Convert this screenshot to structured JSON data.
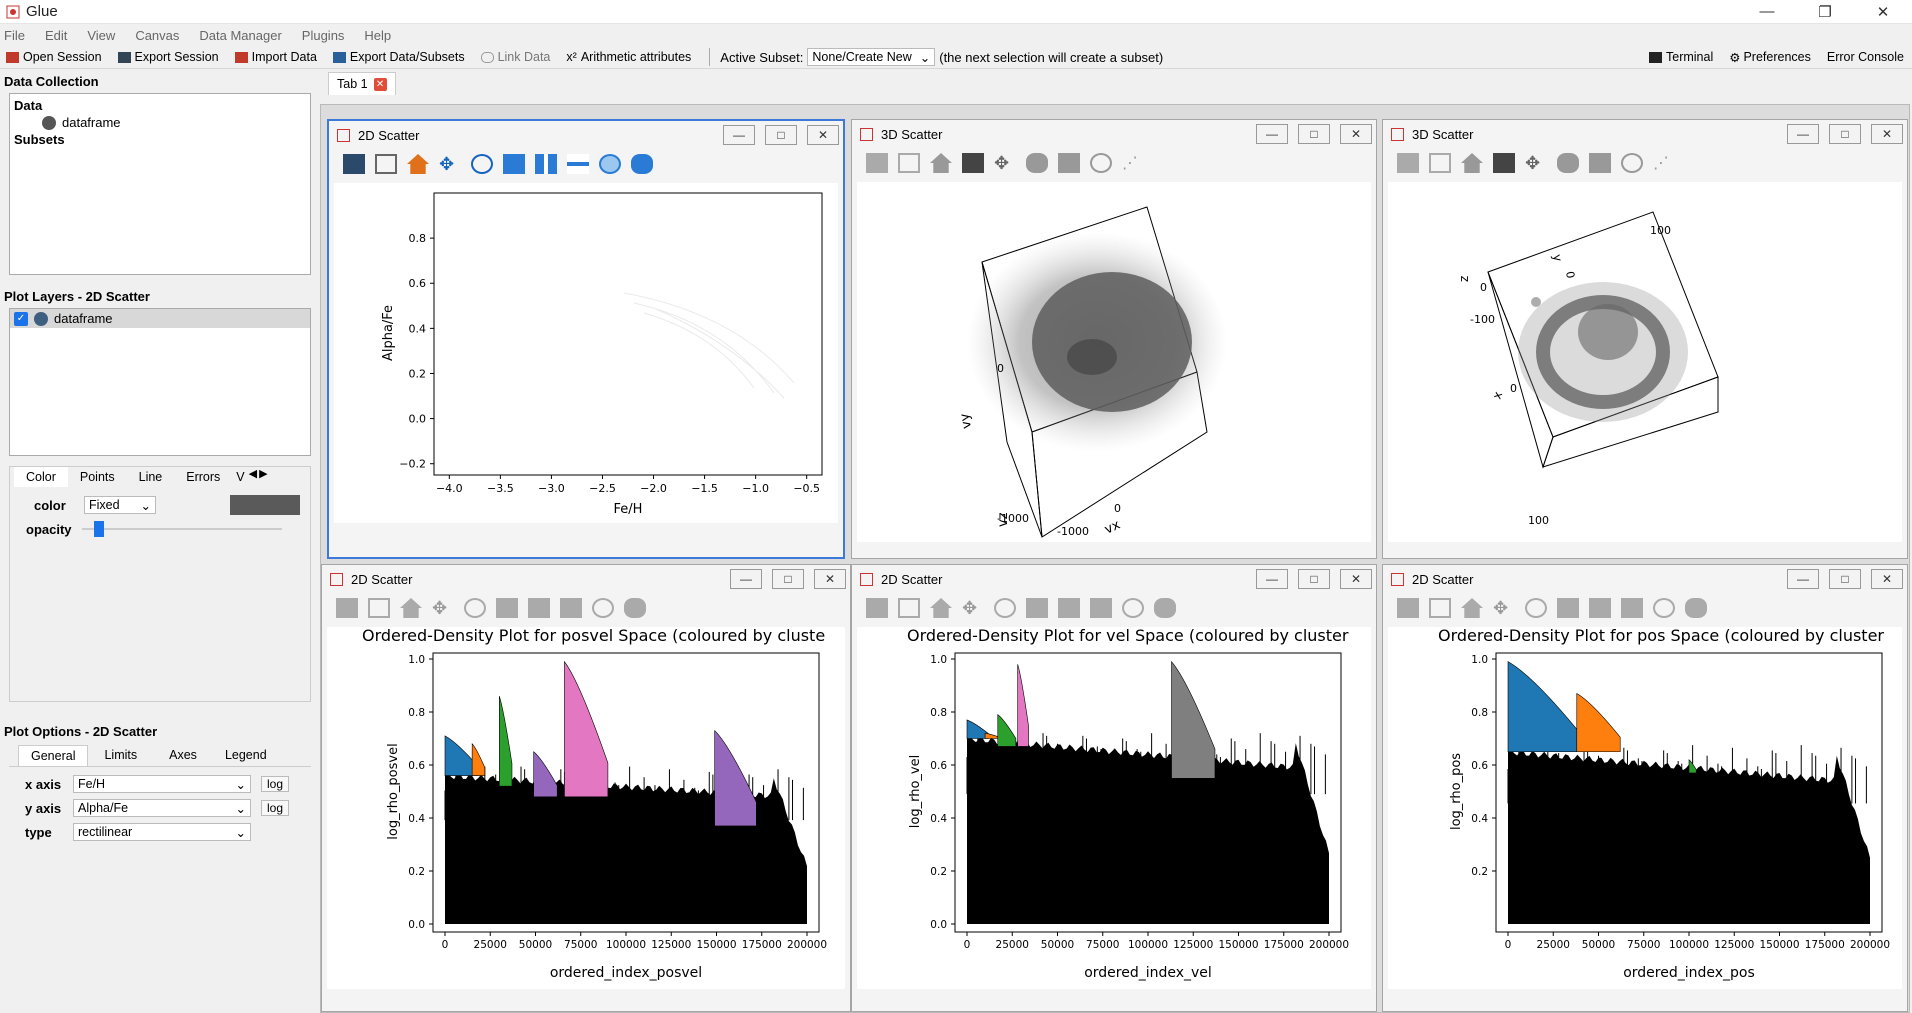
{
  "window": {
    "title": "Glue",
    "min": "—",
    "max": "❐",
    "close": "✕"
  },
  "menu": [
    "File",
    "Edit",
    "View",
    "Canvas",
    "Data Manager",
    "Plugins",
    "Help"
  ],
  "toolbar": {
    "open": "Open Session",
    "export": "Export Session",
    "import": "Import Data",
    "exportdata": "Export Data/Subsets",
    "link": "Link Data",
    "arith": "Arithmetic attributes",
    "active_label": "Active Subset:",
    "active_value": "None/Create New",
    "note": "(the next selection will create a subset)",
    "terminal": "Terminal",
    "prefs": "Preferences",
    "errcon": "Error Console"
  },
  "left": {
    "data_collection": "Data Collection",
    "data": "Data",
    "dataset": "dataframe",
    "subsets": "Subsets",
    "layers_title": "Plot Layers - 2D Scatter",
    "layer": "dataframe",
    "layer_tabs": [
      "Color",
      "Points",
      "Line",
      "Errors",
      "V"
    ],
    "color_label": "color",
    "color_mode": "Fixed",
    "opacity_label": "opacity",
    "options_title": "Plot Options - 2D Scatter",
    "opt_tabs": [
      "General",
      "Limits",
      "Axes",
      "Legend"
    ],
    "x_label": "x axis",
    "x_value": "Fe/H",
    "y_label": "y axis",
    "y_value": "Alpha/Fe",
    "type_label": "type",
    "type_value": "rectilinear",
    "log": "log"
  },
  "tab": "Tab 1",
  "colors": {
    "blue": "#1f77b4",
    "orange": "#ff7f0e",
    "green": "#2ca02c",
    "purple": "#9467bd",
    "pink": "#e377c2",
    "gray": "#7f7f7f",
    "accent": "#3c79d8"
  },
  "panels": {
    "p1": {
      "title": "2D Scatter"
    },
    "p2": {
      "title": "3D Scatter",
      "ax_vx": "vx",
      "ax_vy": "vy",
      "ax_vz": "vz",
      "t0a": "0",
      "t0b": "0",
      "tm1000a": "-1000",
      "tm1000b": "-1000"
    },
    "p3": {
      "title": "3D Scatter",
      "ax_x": "x",
      "ax_y": "y",
      "ax_z": "z",
      "t100a": "100",
      "t100b": "100",
      "t0a": "0",
      "t0b": "0",
      "t0c": "0",
      "tm100": "-100"
    },
    "p4": {
      "title": "2D Scatter"
    },
    "p5": {
      "title": "2D Scatter"
    },
    "p6": {
      "title": "2D Scatter"
    }
  },
  "chart_data": [
    {
      "type": "scatter",
      "xlabel": "Fe/H",
      "ylabel": "Alpha/Fe",
      "xlim": [
        -4.15,
        -0.35
      ],
      "ylim": [
        -0.25,
        1.0
      ],
      "xticks": [
        "−4.0",
        "−3.5",
        "−3.0",
        "−2.5",
        "−2.0",
        "−1.5",
        "−1.0",
        "−0.5"
      ],
      "yticks": [
        "−0.2",
        "0.0",
        "0.2",
        "0.4",
        "0.6",
        "0.8"
      ]
    },
    {
      "type": "bar",
      "title": "Ordered-Density Plot for posvel Space (coloured by cluste",
      "xlabel": "ordered_index_posvel",
      "ylabel": "log_rho_posvel",
      "xlim": [
        0,
        200000
      ],
      "ylim": [
        0,
        1.0
      ],
      "xticks": [
        "0",
        "25000",
        "50000",
        "75000",
        "100000",
        "125000",
        "150000",
        "175000",
        "200000"
      ],
      "yticks": [
        "0.0",
        "0.2",
        "0.4",
        "0.6",
        "0.8",
        "1.0"
      ],
      "clusters": [
        {
          "color": "blue",
          "start": 0,
          "end": 18000,
          "top": 0.71,
          "base": 0.56
        },
        {
          "color": "orange",
          "start": 15000,
          "end": 22000,
          "top": 0.68,
          "base": 0.56
        },
        {
          "color": "green",
          "start": 30000,
          "end": 37000,
          "top": 0.86,
          "base": 0.52
        },
        {
          "color": "purple",
          "start": 49000,
          "end": 62000,
          "top": 0.65,
          "base": 0.48
        },
        {
          "color": "pink",
          "start": 66000,
          "end": 90000,
          "top": 0.99,
          "base": 0.48
        },
        {
          "color": "purple",
          "start": 149000,
          "end": 172000,
          "top": 0.73,
          "base": 0.37
        }
      ]
    },
    {
      "type": "bar",
      "title": "Ordered-Density Plot for vel Space (coloured by cluster",
      "xlabel": "ordered_index_vel",
      "ylabel": "log_rho_vel",
      "xlim": [
        0,
        200000
      ],
      "ylim": [
        0,
        1.0
      ],
      "xticks": [
        "0",
        "25000",
        "50000",
        "75000",
        "100000",
        "125000",
        "150000",
        "175000",
        "200000"
      ],
      "yticks": [
        "0.0",
        "0.2",
        "0.4",
        "0.6",
        "0.8",
        "1.0"
      ],
      "clusters": [
        {
          "color": "blue",
          "start": 0,
          "end": 12000,
          "top": 0.77,
          "base": 0.7
        },
        {
          "color": "orange",
          "start": 10000,
          "end": 18000,
          "top": 0.72,
          "base": 0.7
        },
        {
          "color": "green",
          "start": 17000,
          "end": 27000,
          "top": 0.79,
          "base": 0.67
        },
        {
          "color": "pink",
          "start": 28000,
          "end": 34000,
          "top": 0.98,
          "base": 0.67
        },
        {
          "color": "gray",
          "start": 113000,
          "end": 137000,
          "top": 0.99,
          "base": 0.55
        }
      ]
    },
    {
      "type": "bar",
      "title": "Ordered-Density Plot for pos Space (coloured by cluster",
      "xlabel": "ordered_index_pos",
      "ylabel": "log_rho_pos",
      "xlim": [
        0,
        200000
      ],
      "ylim": [
        0,
        1.0
      ],
      "xticks": [
        "0",
        "25000",
        "50000",
        "75000",
        "100000",
        "125000",
        "150000",
        "175000",
        "200000"
      ],
      "yticks": [
        "0.2",
        "0.4",
        "0.6",
        "0.8",
        "1.0"
      ],
      "clusters": [
        {
          "color": "blue",
          "start": 0,
          "end": 38000,
          "top": 0.99,
          "base": 0.65
        },
        {
          "color": "orange",
          "start": 38000,
          "end": 62000,
          "top": 0.87,
          "base": 0.65
        },
        {
          "color": "green",
          "start": 100000,
          "end": 104000,
          "top": 0.62,
          "base": 0.57
        }
      ]
    }
  ]
}
